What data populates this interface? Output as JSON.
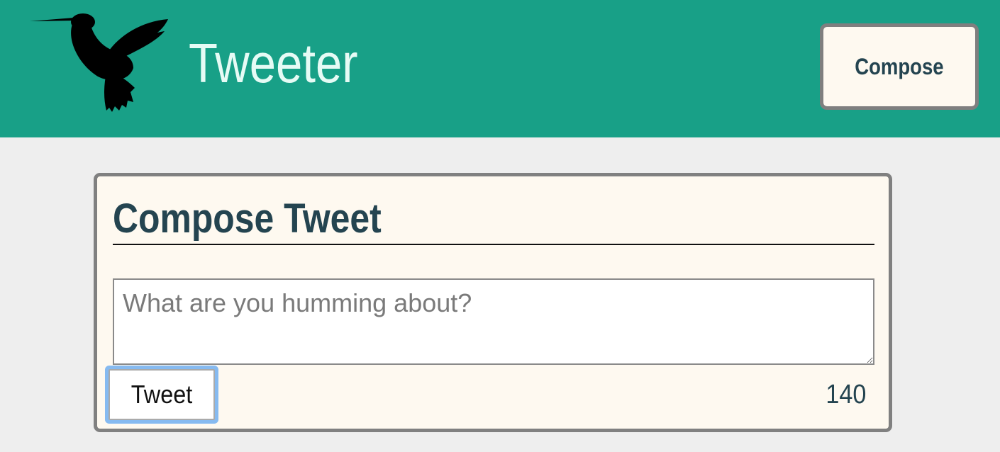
{
  "header": {
    "app_title": "Tweeter",
    "compose_label": "Compose",
    "logo_icon": "hummingbird-icon",
    "background_color": "#18a087"
  },
  "composer": {
    "title": "Compose Tweet",
    "input_placeholder": "What are you humming about?",
    "input_value": "",
    "tweet_label": "Tweet",
    "char_counter": "140"
  },
  "colors": {
    "accent_text": "#244450",
    "panel_background": "#fef9f0",
    "page_background": "#eeeeee",
    "focus_ring": "#86baf0"
  }
}
